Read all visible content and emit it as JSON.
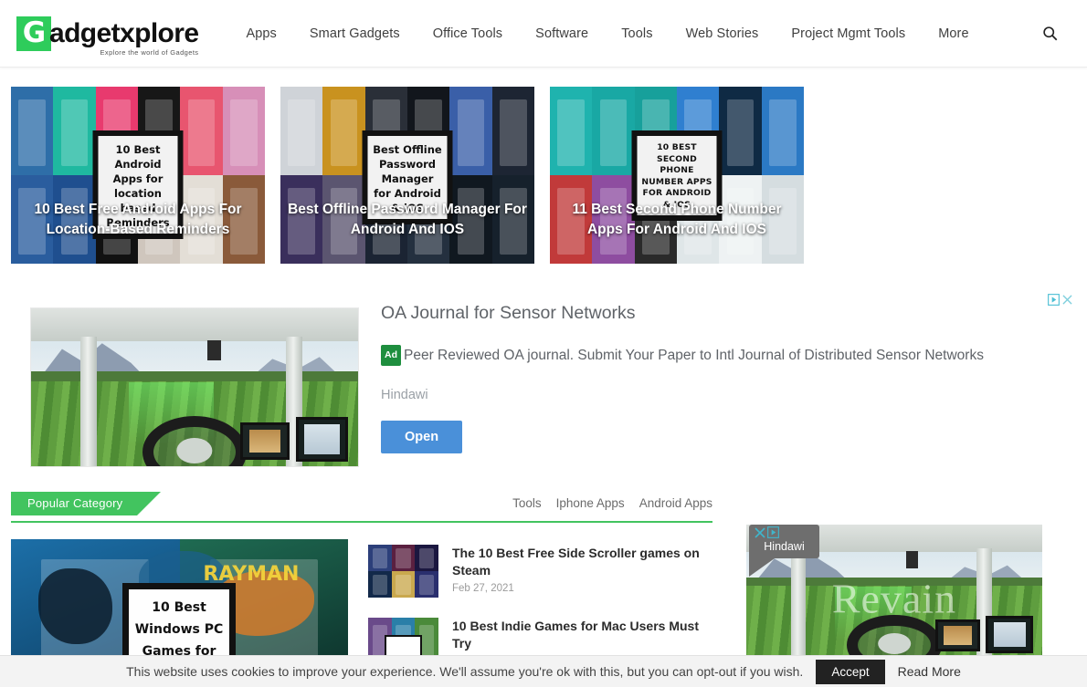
{
  "site": {
    "logo_letter": "G",
    "logo_word": "adgetxplore",
    "logo_tagline": "Explore the world of Gadgets"
  },
  "nav": {
    "items": [
      {
        "label": "Apps"
      },
      {
        "label": "Smart Gadgets"
      },
      {
        "label": "Office Tools"
      },
      {
        "label": "Software"
      },
      {
        "label": "Tools"
      },
      {
        "label": "Web Stories"
      },
      {
        "label": "Project Mgmt Tools"
      },
      {
        "label": "More"
      }
    ],
    "search_icon": "search-icon"
  },
  "hero_cards": [
    {
      "overlay_title": "10 Best Free Android Apps For Location-Based Reminders",
      "inner_text": "10 Best Android Apps for location based Reminders"
    },
    {
      "overlay_title": "Best Offline Password Manager For Android And IOS",
      "inner_text": "Best Offline Password Manager for Android & iOS"
    },
    {
      "overlay_title": "11 Best Second Phone Number Apps For Android And IOS",
      "inner_text": "10 BEST SECOND PHONE NUMBER APPS FOR ANDROID & IOS"
    }
  ],
  "ad_main": {
    "headline": "OA Journal for Sensor Networks",
    "badge": "Ad",
    "description": "Peer Reviewed OA journal. Submit Your Paper to Intl Journal of Distributed Sensor Networks",
    "advertiser": "Hindawi",
    "cta_label": "Open",
    "adchoices_icon": "adchoices-icon",
    "close_icon": "close-icon",
    "accent_color": "#4a90d9",
    "badge_color": "#1e8e3e"
  },
  "popular_category": {
    "label": "Popular Category",
    "accent_color": "#42c45f",
    "tabs": [
      {
        "label": "Tools"
      },
      {
        "label": "Iphone Apps"
      },
      {
        "label": "Android Apps"
      }
    ],
    "feature": {
      "inner_text": "10 Best Windows PC Games for"
    },
    "items": [
      {
        "title": "The 10 Best Free Side Scroller games on Steam",
        "date": "Feb 27, 2021"
      },
      {
        "title": "10 Best Indie Games for Mac Users Must Try",
        "date": ""
      }
    ]
  },
  "ad_sidebar": {
    "advertiser": "Hindawi",
    "close_icon": "close-icon",
    "adchoices_icon": "adchoices-icon",
    "watermark": "Revain"
  },
  "cookie_bar": {
    "message": "This website uses cookies to improve your experience. We'll assume you're ok with this, but you can opt-out if you wish.",
    "accept_label": "Accept",
    "read_more_label": "Read More"
  }
}
